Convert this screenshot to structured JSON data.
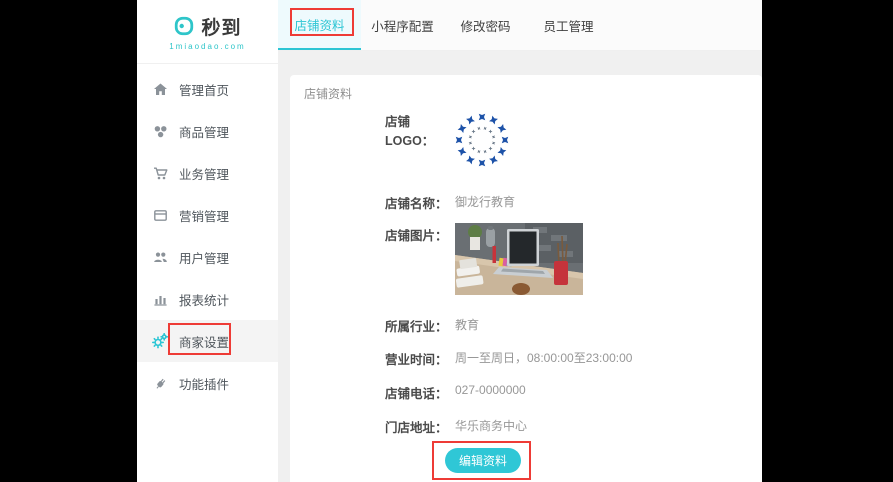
{
  "brand": {
    "name": "秒到",
    "domain": "1miaodao.com"
  },
  "sidebar": {
    "items": [
      {
        "label": "管理首页",
        "icon": "home-icon"
      },
      {
        "label": "商品管理",
        "icon": "products-icon"
      },
      {
        "label": "业务管理",
        "icon": "cart-icon"
      },
      {
        "label": "营销管理",
        "icon": "marketing-icon"
      },
      {
        "label": "用户管理",
        "icon": "users-icon"
      },
      {
        "label": "报表统计",
        "icon": "bar-chart-icon"
      },
      {
        "label": "商家设置",
        "icon": "gears-icon",
        "active": true
      },
      {
        "label": "功能插件",
        "icon": "plug-icon"
      }
    ]
  },
  "tabs": [
    {
      "label": "店铺资料",
      "active": true
    },
    {
      "label": "小程序配置",
      "active": false
    },
    {
      "label": "修改密码",
      "active": false
    },
    {
      "label": "员工管理",
      "active": false
    }
  ],
  "panel": {
    "title": "店铺资料"
  },
  "profile": {
    "logo_label": "店铺LOGO：",
    "name_label": "店铺名称：",
    "name_value": "御龙行教育",
    "image_label": "店铺图片：",
    "industry_label": "所属行业：",
    "industry_value": "教育",
    "hours_label": "营业时间：",
    "hours_value": "周一至周日，08:00:00至23:00:00",
    "phone_label": "店铺电话：",
    "phone_value": "027-0000000",
    "address_label": "门店地址：",
    "address_value": "华乐商务中心",
    "edit_button": "编辑资料"
  },
  "colors": {
    "accent": "#2bc5d4",
    "brand_teal": "#2ec5c9",
    "annotation_red": "#ee3b36",
    "emblem_blue": "#1d52a8"
  }
}
